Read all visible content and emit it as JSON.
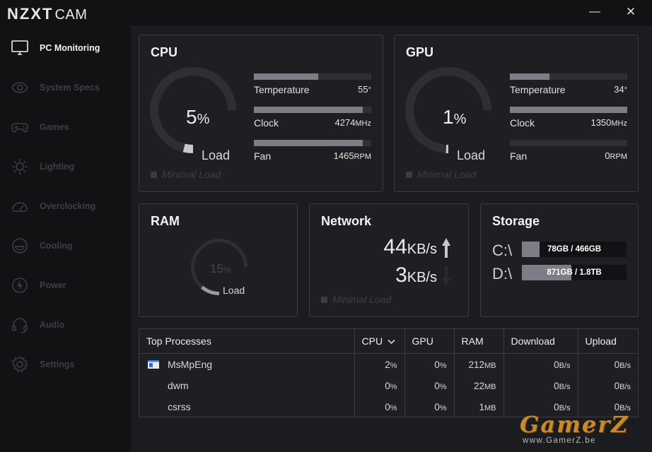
{
  "app": {
    "brand": "NZXT",
    "product": "CAM"
  },
  "window": {
    "minimize": "—",
    "close": "✕"
  },
  "sidebar": {
    "items": [
      {
        "label": "PC Monitoring",
        "icon": "monitor-icon",
        "active": true
      },
      {
        "label": "System Specs",
        "icon": "eye-icon"
      },
      {
        "label": "Games",
        "icon": "gamepad-icon"
      },
      {
        "label": "Lighting",
        "icon": "sun-icon"
      },
      {
        "label": "Overclocking",
        "icon": "speedometer-icon"
      },
      {
        "label": "Cooling",
        "icon": "fan-icon"
      },
      {
        "label": "Power",
        "icon": "lightning-icon"
      },
      {
        "label": "Audio",
        "icon": "headset-icon"
      },
      {
        "label": "Settings",
        "icon": "gear-icon"
      }
    ]
  },
  "cpu": {
    "title": "CPU",
    "load_value": "5",
    "load_unit": "%",
    "load_fraction": 0.05,
    "load_label": "Load",
    "minimal_label": "Minimal Load",
    "metrics": [
      {
        "label": "Temperature",
        "value": "55",
        "unit": "°",
        "fill": 0.55
      },
      {
        "label": "Clock",
        "value": "4274",
        "unit": "MHz",
        "fill": 0.93
      },
      {
        "label": "Fan",
        "value": "1465",
        "unit": "RPM",
        "fill": 0.93
      }
    ]
  },
  "gpu": {
    "title": "GPU",
    "load_value": "1",
    "load_unit": "%",
    "load_fraction": 0.01,
    "load_label": "Load",
    "minimal_label": "Minimal Load",
    "metrics": [
      {
        "label": "Temperature",
        "value": "34",
        "unit": "°",
        "fill": 0.34
      },
      {
        "label": "Clock",
        "value": "1350",
        "unit": "MHz",
        "fill": 1.0
      },
      {
        "label": "Fan",
        "value": "0",
        "unit": "RPM",
        "fill": 0.0
      }
    ]
  },
  "ram": {
    "title": "RAM",
    "load_value": "15",
    "load_unit": "%",
    "load_fraction": 0.15,
    "load_label": "Load"
  },
  "network": {
    "title": "Network",
    "minimal_label": "Minimal Load",
    "download_value": "44",
    "download_unit": "KB/s",
    "upload_value": "3",
    "upload_unit": "KB/s"
  },
  "storage": {
    "title": "Storage",
    "drives": [
      {
        "letter": "C:\\",
        "text": "78GB / 466GB",
        "fill": 0.17
      },
      {
        "letter": "D:\\",
        "text": "871GB / 1.8TB",
        "fill": 0.47
      }
    ]
  },
  "processes": {
    "headers": [
      "Top Processes",
      "CPU",
      "GPU",
      "RAM",
      "Download",
      "Upload"
    ],
    "sort_icon": "chevron-down-icon",
    "rows": [
      {
        "name": "MsMpEng",
        "cpu": "2",
        "gpu": "0",
        "ram": "212",
        "download": "0",
        "upload": "0",
        "has_icon": true
      },
      {
        "name": "dwm",
        "cpu": "0",
        "gpu": "0",
        "ram": "22",
        "download": "0",
        "upload": "0"
      },
      {
        "name": "csrss",
        "cpu": "0",
        "gpu": "0",
        "ram": "1",
        "download": "0",
        "upload": "0"
      }
    ],
    "units": {
      "pct": "%",
      "mem": "MB",
      "rate": "B/s"
    }
  },
  "watermark": {
    "big": "GamerZ",
    "small": "www.GamerZ.be"
  },
  "colors": {
    "accent": "#7c7d86",
    "track": "#2f3034",
    "background": "#1b1c1f",
    "sidebar": "#111214",
    "watermark": "#c98a2a"
  }
}
